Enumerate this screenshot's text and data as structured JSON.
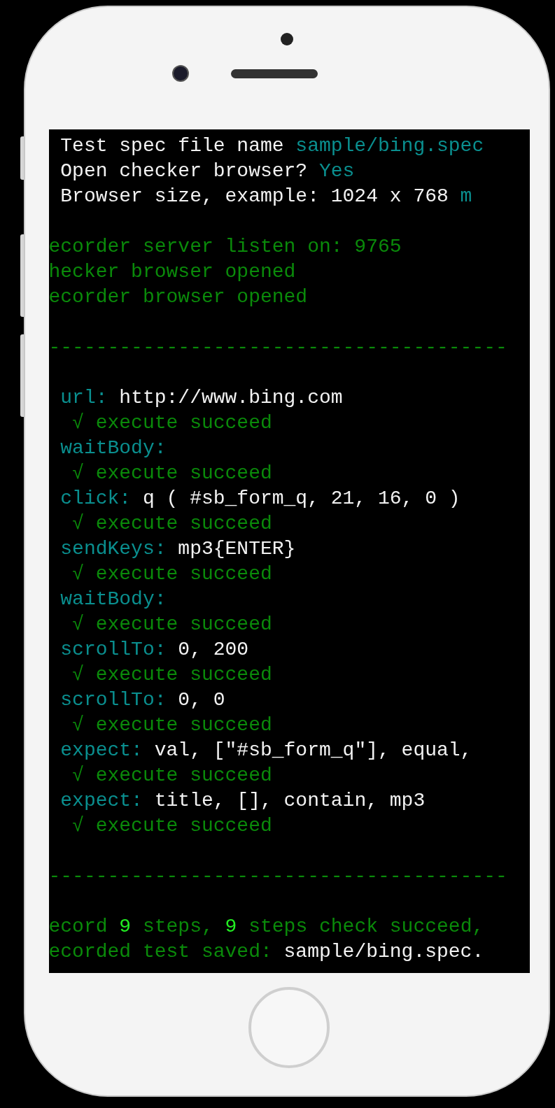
{
  "terminal": {
    "lines": [
      {
        "kind": "text",
        "segments": [
          {
            "text": " Test spec file name ",
            "color": "#f2f2f2"
          },
          {
            "text": "sample/bing.spec",
            "color": "#0a8f8f"
          }
        ]
      },
      {
        "kind": "text",
        "segments": [
          {
            "text": " Open checker browser? ",
            "color": "#f2f2f2"
          },
          {
            "text": "Yes",
            "color": "#0a8f8f"
          }
        ]
      },
      {
        "kind": "text",
        "segments": [
          {
            "text": " Browser size, example: 1024 x 768 ",
            "color": "#f2f2f2"
          },
          {
            "text": "m",
            "color": "#0a8f8f"
          }
        ]
      },
      {
        "kind": "blank"
      },
      {
        "kind": "text",
        "segments": [
          {
            "text": "ecorder server listen on: 9765",
            "color": "#0a8a0a"
          }
        ]
      },
      {
        "kind": "text",
        "segments": [
          {
            "text": "hecker browser opened",
            "color": "#0a8a0a"
          }
        ]
      },
      {
        "kind": "text",
        "segments": [
          {
            "text": "ecorder browser opened",
            "color": "#0a8a0a"
          }
        ]
      },
      {
        "kind": "blank"
      },
      {
        "kind": "rule",
        "segments": [
          {
            "text": "---------------------------------------",
            "color": "#0a8a0a"
          }
        ]
      },
      {
        "kind": "blank"
      },
      {
        "kind": "text",
        "segments": [
          {
            "text": " url: ",
            "color": "#0a8f8f"
          },
          {
            "text": "http://www.bing.com",
            "color": "#f2f2f2"
          }
        ]
      },
      {
        "kind": "text",
        "segments": [
          {
            "text": "  √ execute succeed",
            "color": "#0a8a0a"
          }
        ]
      },
      {
        "kind": "text",
        "segments": [
          {
            "text": " waitBody:",
            "color": "#0a8f8f"
          }
        ]
      },
      {
        "kind": "text",
        "segments": [
          {
            "text": "  √ execute succeed",
            "color": "#0a8a0a"
          }
        ]
      },
      {
        "kind": "text",
        "segments": [
          {
            "text": " click: ",
            "color": "#0a8f8f"
          },
          {
            "text": "q ( #sb_form_q, 21, 16, 0 )",
            "color": "#f2f2f2"
          }
        ]
      },
      {
        "kind": "text",
        "segments": [
          {
            "text": "  √ execute succeed",
            "color": "#0a8a0a"
          }
        ]
      },
      {
        "kind": "text",
        "segments": [
          {
            "text": " sendKeys: ",
            "color": "#0a8f8f"
          },
          {
            "text": "mp3{ENTER}",
            "color": "#f2f2f2"
          }
        ]
      },
      {
        "kind": "text",
        "segments": [
          {
            "text": "  √ execute succeed",
            "color": "#0a8a0a"
          }
        ]
      },
      {
        "kind": "text",
        "segments": [
          {
            "text": " waitBody:",
            "color": "#0a8f8f"
          }
        ]
      },
      {
        "kind": "text",
        "segments": [
          {
            "text": "  √ execute succeed",
            "color": "#0a8a0a"
          }
        ]
      },
      {
        "kind": "text",
        "segments": [
          {
            "text": " scrollTo: ",
            "color": "#0a8f8f"
          },
          {
            "text": "0, 200",
            "color": "#f2f2f2"
          }
        ]
      },
      {
        "kind": "text",
        "segments": [
          {
            "text": "  √ execute succeed",
            "color": "#0a8a0a"
          }
        ]
      },
      {
        "kind": "text",
        "segments": [
          {
            "text": " scrollTo: ",
            "color": "#0a8f8f"
          },
          {
            "text": "0, 0",
            "color": "#f2f2f2"
          }
        ]
      },
      {
        "kind": "text",
        "segments": [
          {
            "text": "  √ execute succeed",
            "color": "#0a8a0a"
          }
        ]
      },
      {
        "kind": "text",
        "segments": [
          {
            "text": " expect: ",
            "color": "#0a8f8f"
          },
          {
            "text": "val, [\"#sb_form_q\"], equal,",
            "color": "#f2f2f2"
          }
        ]
      },
      {
        "kind": "text",
        "segments": [
          {
            "text": "  √ execute succeed",
            "color": "#0a8a0a"
          }
        ]
      },
      {
        "kind": "text",
        "segments": [
          {
            "text": " expect: ",
            "color": "#0a8f8f"
          },
          {
            "text": "title, [], contain, mp3",
            "color": "#f2f2f2"
          }
        ]
      },
      {
        "kind": "text",
        "segments": [
          {
            "text": "  √ execute succeed",
            "color": "#0a8a0a"
          }
        ]
      },
      {
        "kind": "blank"
      },
      {
        "kind": "rule",
        "segments": [
          {
            "text": "---------------------------------------",
            "color": "#0a8a0a"
          }
        ]
      },
      {
        "kind": "blank"
      },
      {
        "kind": "text",
        "segments": [
          {
            "text": "ecord ",
            "color": "#0a8a0a"
          },
          {
            "text": "9",
            "color": "#22ee22"
          },
          {
            "text": " steps, ",
            "color": "#0a8a0a"
          },
          {
            "text": "9",
            "color": "#22ee22"
          },
          {
            "text": " steps check succeed,",
            "color": "#0a8a0a"
          }
        ]
      },
      {
        "kind": "text",
        "segments": [
          {
            "text": "ecorded test saved: ",
            "color": "#0a8a0a"
          },
          {
            "text": "sample/bing.spec.",
            "color": "#f2f2f2"
          }
        ]
      }
    ]
  }
}
